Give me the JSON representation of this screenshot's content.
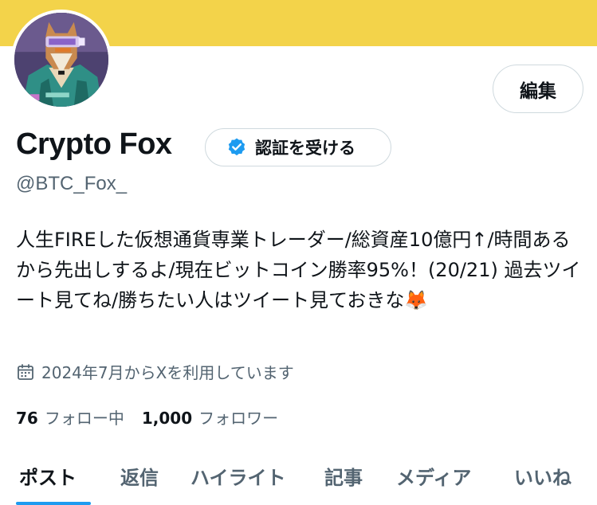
{
  "colors": {
    "banner": "#f3d34a",
    "verified": "#1d9bf0",
    "secondary_text": "#536471"
  },
  "profile": {
    "name": "Crypto Fox",
    "handle": "@BTC_Fox_",
    "bio": "人生FIREした仮想通貨専業トレーダー/総資産10億円↑/時間あるから先出しするよ/現在ビットコイン勝率95%！(20/21) 過去ツイート見てね/勝ちたい人はツイート見ておきな🦊",
    "joined": "2024年7月からXを利用しています",
    "following_count": "76",
    "following_label": "フォロー中",
    "followers_count": "1,000",
    "followers_label": "フォロワー"
  },
  "buttons": {
    "edit": "編集",
    "verify": "認証を受ける"
  },
  "icons": {
    "verify": "verified-badge-icon",
    "joined": "calendar-icon"
  },
  "tabs": [
    {
      "label": "ポスト",
      "active": true
    },
    {
      "label": "返信"
    },
    {
      "label": "ハイライト"
    },
    {
      "label": "記事"
    },
    {
      "label": "メディア"
    },
    {
      "label": "いいね"
    }
  ]
}
